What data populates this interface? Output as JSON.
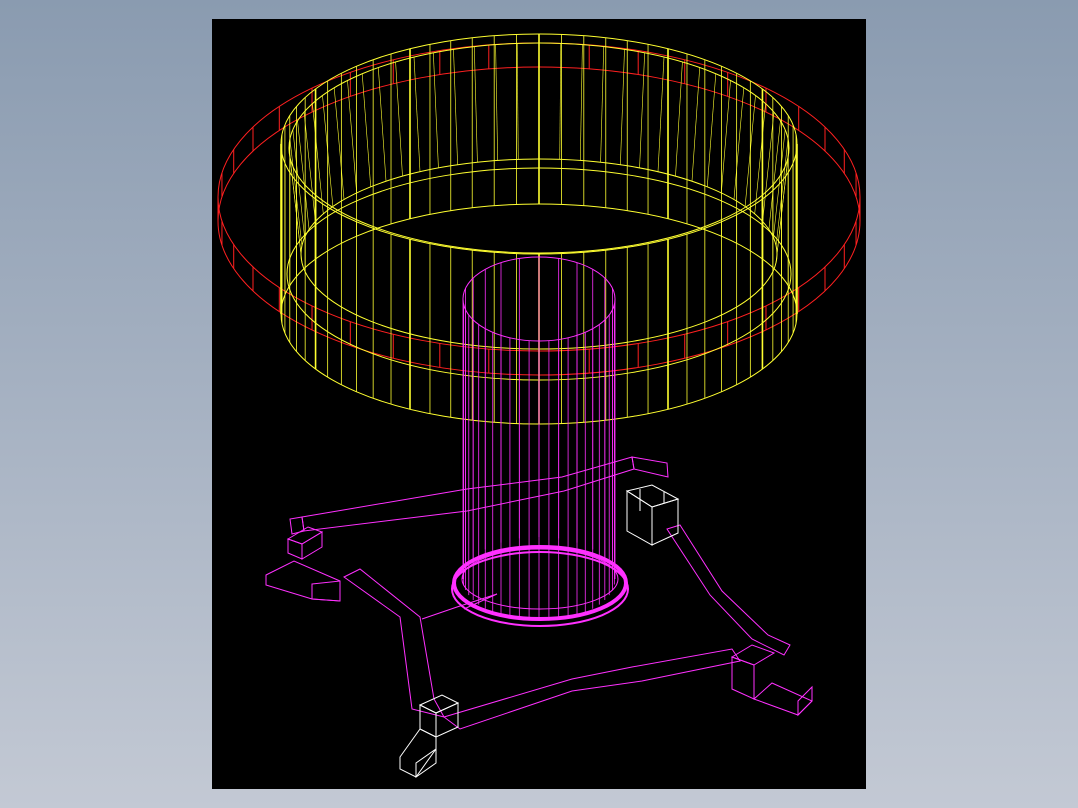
{
  "viewport": {
    "background_color": "#000000",
    "display_mode": "wireframe"
  },
  "colors": {
    "red_ring": "#ff2020",
    "yellow_tub": "#ffff30",
    "magenta": "#ff30ff",
    "white_blocks": "#ffffff"
  },
  "parts": [
    {
      "name": "red-ring",
      "color_key": "red_ring"
    },
    {
      "name": "yellow-tub",
      "color_key": "yellow_tub"
    },
    {
      "name": "magenta-column",
      "color_key": "magenta"
    },
    {
      "name": "magenta-base-frame",
      "color_key": "magenta"
    },
    {
      "name": "white-foot-blocks",
      "color_key": "white_blocks"
    }
  ]
}
